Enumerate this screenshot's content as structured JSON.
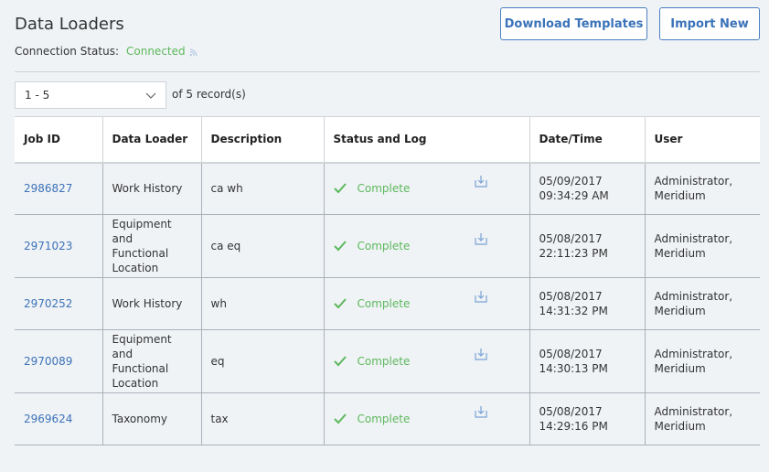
{
  "header": {
    "title": "Data Loaders",
    "connection_label": "Connection Status:",
    "connection_value": "Connected",
    "connection_icon": "wifi-icon",
    "download_templates_label": "Download Templates",
    "import_new_label": "Import New"
  },
  "pager": {
    "range": "1 - 5",
    "of_text": "of 5 record(s)"
  },
  "colors": {
    "accent": "#3b73b9",
    "success": "#5cb85c"
  },
  "table": {
    "columns": [
      "Job ID",
      "Data Loader",
      "Description",
      "Status and Log",
      "Date/Time",
      "User"
    ],
    "rows": [
      {
        "job_id": "2986827",
        "loader": "Work History",
        "description": "ca wh",
        "status": "Complete",
        "date": "05/09/2017",
        "time": "09:34:29 AM",
        "user_1": "Administrator,",
        "user_2": "Meridium"
      },
      {
        "job_id": "2971023",
        "loader": "Equipment and Functional Location",
        "description": "ca eq",
        "status": "Complete",
        "date": "05/08/2017",
        "time": "22:11:23 PM",
        "user_1": "Administrator,",
        "user_2": "Meridium"
      },
      {
        "job_id": "2970252",
        "loader": "Work History",
        "description": "wh",
        "status": "Complete",
        "date": "05/08/2017",
        "time": "14:31:32 PM",
        "user_1": "Administrator,",
        "user_2": "Meridium"
      },
      {
        "job_id": "2970089",
        "loader": "Equipment and Functional Location",
        "description": "eq",
        "status": "Complete",
        "date": "05/08/2017",
        "time": "14:30:13 PM",
        "user_1": "Administrator,",
        "user_2": "Meridium"
      },
      {
        "job_id": "2969624",
        "loader": "Taxonomy",
        "description": "tax",
        "status": "Complete",
        "date": "05/08/2017",
        "time": "14:29:16 PM",
        "user_1": "Administrator,",
        "user_2": "Meridium"
      }
    ]
  }
}
